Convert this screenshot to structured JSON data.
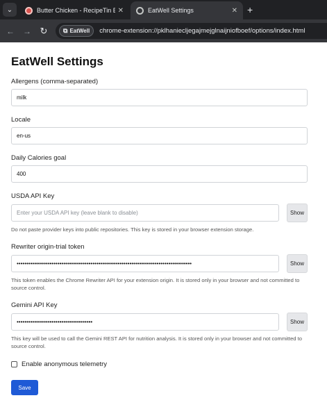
{
  "browser": {
    "tabs": [
      {
        "title": "Butter Chicken - RecipeTin Eats",
        "active": false,
        "icon": "recipe-favicon"
      },
      {
        "title": "EatWell Settings",
        "active": true,
        "icon": "gear-icon"
      }
    ],
    "new_tab_symbol": "+",
    "close_symbol": "✕",
    "extension_chip": "EatWell",
    "url": "chrome-extension://pklhaniecljegajmejglnaijniofboef/options/index.html"
  },
  "page": {
    "title": "EatWell Settings",
    "allergens": {
      "label": "Allergens (comma-separated)",
      "value": "milk"
    },
    "locale": {
      "label": "Locale",
      "value": "en-us"
    },
    "calories": {
      "label": "Daily Calories goal",
      "value": "400"
    },
    "usda": {
      "label": "USDA API Key",
      "value": "",
      "placeholder": "Enter your USDA API key (leave blank to disable)",
      "show_label": "Show",
      "help": "Do not paste provider keys into public repositories. This key is stored in your browser extension storage."
    },
    "rewriter": {
      "label": "Rewriter origin-trial token",
      "masked": "••••••••••••••••••••••••••••••••••••••••••••••••••••••••••••••••••••••••••••••••••••••••••",
      "show_label": "Show",
      "help": "This token enables the Chrome Rewriter API for your extension origin. It is stored only in your browser and not committed to source control."
    },
    "gemini": {
      "label": "Gemini API Key",
      "masked": "•••••••••••••••••••••••••••••••••••••••",
      "show_label": "Show",
      "help": "This key will be used to call the Gemini REST API for nutrition analysis. It is stored only in your browser and not committed to source control."
    },
    "telemetry": {
      "label": "Enable anonymous telemetry",
      "checked": false
    },
    "save_label": "Save"
  },
  "colors": {
    "primary": "#1f5ad6",
    "chrome_bg": "#202124",
    "toolbar_bg": "#35363a"
  }
}
